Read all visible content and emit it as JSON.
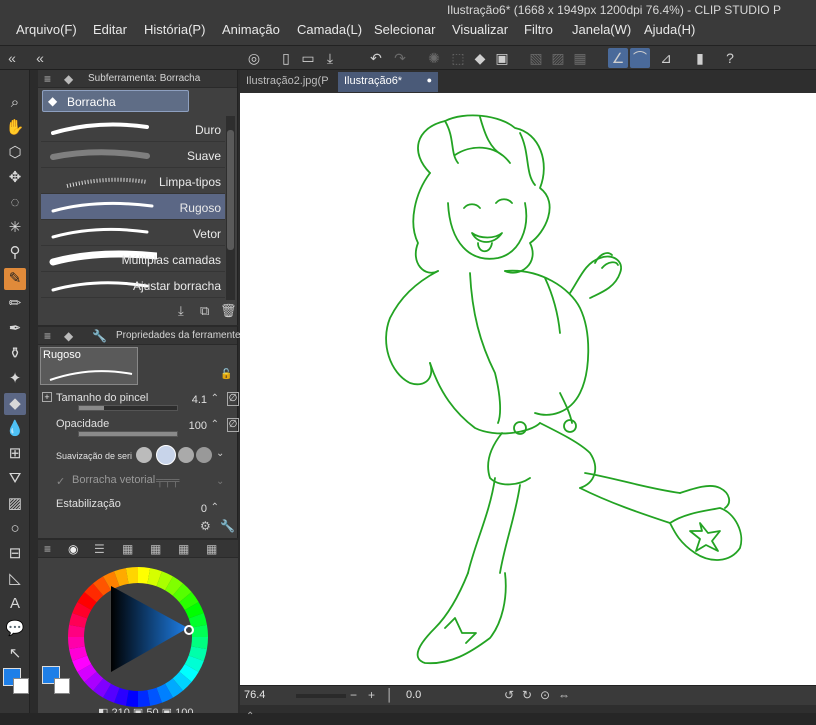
{
  "window_title": "Ilustração6* (1668 x 1949px 1200dpi 76.4%) - CLIP STUDIO P",
  "menu": [
    "Arquivo(F)",
    "Editar",
    "História(P)",
    "Animação",
    "Camada(L)",
    "Selecionar",
    "Visualizar",
    "Filtro",
    "Janela(W)",
    "Ajuda(H)"
  ],
  "subtool_panel": {
    "title": "Subferramenta: Borracha",
    "group": "Borracha",
    "brushes": [
      {
        "label": "Duro",
        "selected": false
      },
      {
        "label": "Suave",
        "selected": false
      },
      {
        "label": "Limpa-tipos",
        "selected": false
      },
      {
        "label": "Rugoso",
        "selected": true
      },
      {
        "label": "Vetor",
        "selected": false
      },
      {
        "label": "Múltiplas camadas",
        "selected": false
      },
      {
        "label": "Ajustar borracha",
        "selected": false
      }
    ]
  },
  "properties_panel": {
    "title": "Propriedades da ferramente",
    "preset_name": "Rugoso",
    "brush_size_label": "Tamanho do pincel",
    "brush_size_value": "4.1",
    "brush_size_fraction": 0.25,
    "opacity_label": "Opacidade",
    "opacity_value": "100",
    "opacity_fraction": 1.0,
    "smoothing_label": "Suavização de seri",
    "vector_eraser_label": "Borracha vetorial",
    "stabilization_label": "Estabilização",
    "stabilization_value": "0"
  },
  "color_panel": {
    "main_color": "#1e7fe8",
    "sub_color": "#ffffff",
    "hsv": [
      "210",
      "50",
      "100"
    ]
  },
  "tabs": [
    "Ilustração2.jpg(P",
    "Ilustração6*"
  ],
  "status": {
    "zoom": "76.4",
    "angle": "0.0"
  },
  "colors": {
    "accent_tool": "#e08a3a",
    "line_art": "#23a323",
    "selection": "#5b6785"
  }
}
